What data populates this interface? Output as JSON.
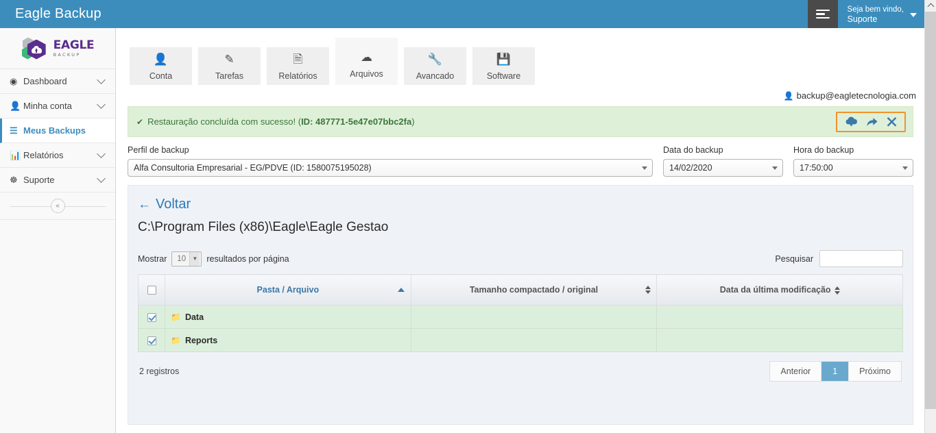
{
  "topbar": {
    "title": "Eagle Backup",
    "hamburger_icon": "hamburger-icon",
    "welcome_line1": "Seja bem vindo,",
    "welcome_line2": "Suporte",
    "accent_color": "#3c8dbc"
  },
  "sidebar": {
    "logo": {
      "name": "EAGLE",
      "sub": "BACKUP"
    },
    "items": [
      {
        "label": "Dashboard",
        "icon": "dashboard-icon",
        "active": false,
        "has_chevron": true
      },
      {
        "label": "Minha conta",
        "icon": "user-icon",
        "active": false,
        "has_chevron": true
      },
      {
        "label": "Meus Backups",
        "icon": "list-icon",
        "active": true,
        "has_chevron": false
      },
      {
        "label": "Relatórios",
        "icon": "bar-chart-icon",
        "active": false,
        "has_chevron": true
      },
      {
        "label": "Suporte",
        "icon": "lifebuoy-icon",
        "active": false,
        "has_chevron": true
      }
    ],
    "collapse_label": "«"
  },
  "tabs": [
    {
      "label": "Conta",
      "icon": "person-icon",
      "active": false
    },
    {
      "label": "Tarefas",
      "icon": "edit-square-icon",
      "active": false
    },
    {
      "label": "Relatórios",
      "icon": "document-list-icon",
      "active": false
    },
    {
      "label": "Arquivos",
      "icon": "cloud-download-icon",
      "active": true
    },
    {
      "label": "Avancado",
      "icon": "wrench-icon",
      "active": false
    },
    {
      "label": "Software",
      "icon": "floppy-save-icon",
      "active": false
    }
  ],
  "account": {
    "icon": "person-icon",
    "email": "backup@eagletecnologia.com"
  },
  "alert": {
    "check_icon": "check-icon",
    "message": "Restauração concluída com sucesso! (",
    "id_label": "ID: 487771-5e47e07bbc2fa",
    "message_tail": ")",
    "bg_color": "#dff0d8",
    "text_color": "#3c763d",
    "highlight_color": "#f0932b",
    "actions": [
      {
        "icon": "cloud-download-icon",
        "glyph": "cloud-down"
      },
      {
        "icon": "share-arrow-icon",
        "glyph": "arrow-redo"
      },
      {
        "icon": "close-icon",
        "glyph": "x"
      }
    ]
  },
  "filters": {
    "profile_label": "Perfil de backup",
    "profile_value": "Alfa Consultoria Empresarial - EG/PDVE (ID: 1580075195028)",
    "date_label": "Data do backup",
    "date_value": "14/02/2020",
    "time_label": "Hora do backup",
    "time_value": "17:50:00"
  },
  "panel": {
    "back_label": "Voltar",
    "back_icon": "arrow-left-icon",
    "path": "C:\\Program Files (x86)\\Eagle\\Eagle Gestao",
    "show_prefix": "Mostrar",
    "page_size": "10",
    "show_suffix": "resultados por página",
    "search_label": "Pesquisar",
    "search_value": "",
    "search_placeholder": ""
  },
  "table": {
    "header_checkbox_checked": false,
    "columns": [
      {
        "label": "Pasta / Arquivo",
        "sort": "asc",
        "key": "name"
      },
      {
        "label": "Tamanho compactado / original",
        "sort": "both",
        "key": "size"
      },
      {
        "label": "Data da última modificação",
        "sort": "both",
        "key": "modified"
      }
    ],
    "rows": [
      {
        "checked": true,
        "icon": "folder-icon",
        "name": "Data",
        "size": "",
        "modified": ""
      },
      {
        "checked": true,
        "icon": "folder-icon",
        "name": "Reports",
        "size": "",
        "modified": ""
      }
    ],
    "row_bg_color": "#dcefdc"
  },
  "footer": {
    "records": "2 registros",
    "pager": {
      "prev": "Anterior",
      "pages": [
        "1"
      ],
      "current": "1",
      "next": "Próximo"
    }
  },
  "scrollbar": {
    "up_icon": "chevron-up-icon"
  }
}
